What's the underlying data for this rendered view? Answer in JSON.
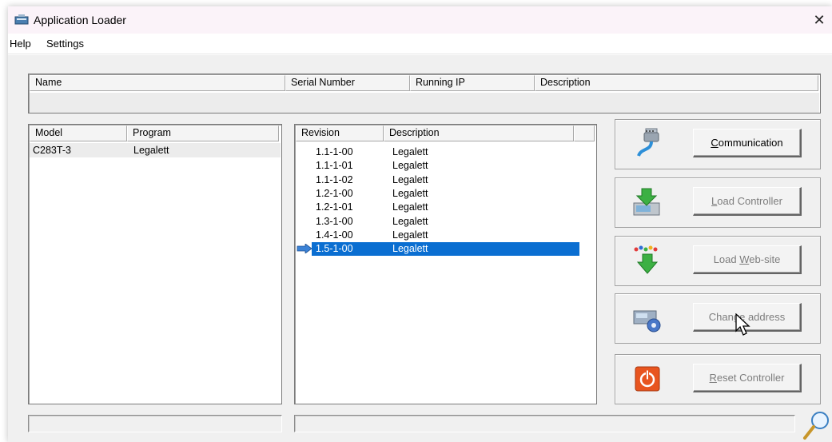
{
  "window": {
    "title": "Application Loader",
    "close_glyph": "✕"
  },
  "menu": [
    "Help",
    "Settings"
  ],
  "devices_table": {
    "columns": [
      "Name",
      "Serial Number",
      "Running IP",
      "Description"
    ],
    "rows": []
  },
  "models_table": {
    "columns": [
      "Model",
      "Program"
    ],
    "rows": [
      {
        "model": "C283T-3",
        "program": "Legalett"
      }
    ]
  },
  "revisions_table": {
    "columns": [
      "Revision",
      "Description"
    ],
    "rows": [
      {
        "revision": "1.1-1-00",
        "description": "Legalett"
      },
      {
        "revision": "1.1-1-01",
        "description": "Legalett"
      },
      {
        "revision": "1.1-1-02",
        "description": "Legalett"
      },
      {
        "revision": "1.2-1-00",
        "description": "Legalett"
      },
      {
        "revision": "1.2-1-01",
        "description": "Legalett"
      },
      {
        "revision": "1.3-1-00",
        "description": "Legalett"
      },
      {
        "revision": "1.4-1-00",
        "description": "Legalett"
      },
      {
        "revision": "1.5-1-00",
        "description": "Legalett"
      }
    ],
    "selected_index": 7
  },
  "buttons": {
    "communication": {
      "prefix": "",
      "mnemonic": "C",
      "suffix": "ommunication",
      "enabled": true,
      "icon": "serial-cable-icon"
    },
    "load_controller": {
      "prefix": "",
      "mnemonic": "L",
      "suffix": "oad Controller",
      "enabled": false,
      "icon": "download-to-controller-icon"
    },
    "load_website": {
      "prefix": "Load ",
      "mnemonic": "W",
      "suffix": "eb-site",
      "enabled": false,
      "icon": "download-website-icon"
    },
    "change_address": {
      "prefix": "Chan",
      "mnemonic": "g",
      "suffix": "e address",
      "enabled": false,
      "icon": "change-address-icon"
    },
    "reset_controller": {
      "prefix": "",
      "mnemonic": "R",
      "suffix": "eset Controller",
      "enabled": false,
      "icon": "power-reset-icon"
    }
  },
  "colors": {
    "selection": "#0a6ed1",
    "title_bg": "#fbf3f9",
    "client_bg": "#f0f0f0",
    "reset_icon": "#e8551f"
  }
}
